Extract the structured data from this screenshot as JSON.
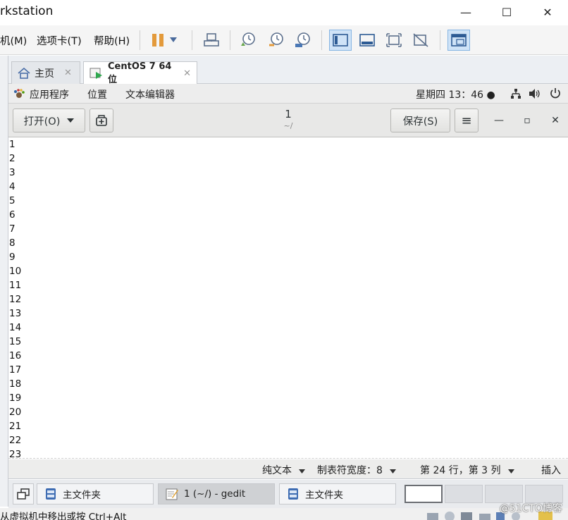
{
  "window": {
    "title": "rkstation",
    "minimize": "—",
    "maximize": "☐",
    "close": "✕"
  },
  "menubar": {
    "items": [
      "机(M)",
      "选项卡(T)",
      "帮助(H)"
    ]
  },
  "tabs": [
    {
      "label": "主页",
      "close": "✕"
    },
    {
      "label": "CentOS 7 64 位",
      "close": "✕"
    }
  ],
  "gnome_bar": {
    "applications": "应用程序",
    "places": "位置",
    "text_editor": "文本编辑器",
    "clock": "星期四 13：46 ●"
  },
  "gedit": {
    "open_label": "打开(O)",
    "save_label": "保存(S)",
    "doc_title": "1",
    "doc_path": "~/",
    "menu_icon": "≡",
    "minimize": "—",
    "maximize": "▫",
    "close": "✕"
  },
  "editor": {
    "lines": [
      "1",
      "2",
      "3",
      "4",
      "5",
      "6",
      "7",
      "8",
      "9",
      "10",
      "11",
      "12",
      "13",
      "14",
      "15",
      "16",
      "17",
      "18",
      "19",
      "20",
      "21",
      "22",
      "23"
    ]
  },
  "statusbar": {
    "language": "纯文本",
    "tab_width": "制表符宽度：8",
    "position": "第 24 行，第 3 列",
    "mode": "插入"
  },
  "taskbar": {
    "tasks": [
      "主文件夹",
      "1 (~/) - gedit",
      "主文件夹"
    ]
  },
  "bottom": {
    "message": "从虚拟机中移出或按 Ctrl+Alt",
    "watermark": "@51CTO博客"
  }
}
